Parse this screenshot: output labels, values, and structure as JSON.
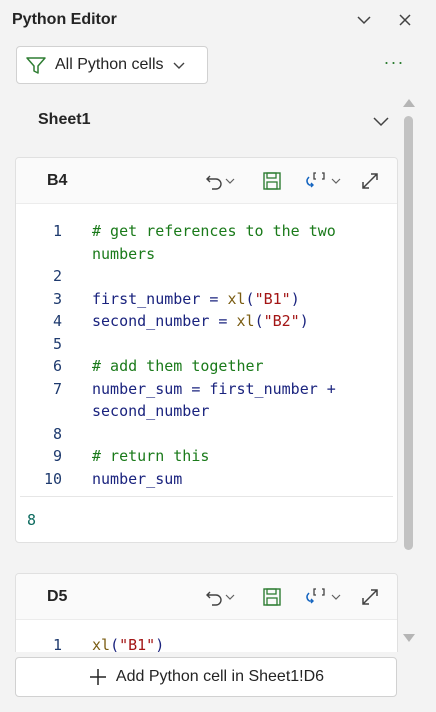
{
  "panel": {
    "title": "Python Editor"
  },
  "filter": {
    "label": "All Python cells"
  },
  "more_label": "···",
  "sheet": {
    "name": "Sheet1"
  },
  "cells": [
    {
      "ref": "B4",
      "lines": [
        {
          "num": "1",
          "parts": [
            {
              "t": "# get references to the two",
              "c": "cm"
            }
          ]
        },
        {
          "num": "",
          "parts": [
            {
              "t": "numbers",
              "c": "cm"
            }
          ]
        },
        {
          "num": "2",
          "parts": []
        },
        {
          "num": "3",
          "parts": [
            {
              "t": "first_number = ",
              "c": ""
            },
            {
              "t": "xl",
              "c": "fn"
            },
            {
              "t": "(",
              "c": ""
            },
            {
              "t": "\"B1\"",
              "c": "st"
            },
            {
              "t": ")",
              "c": ""
            }
          ]
        },
        {
          "num": "4",
          "parts": [
            {
              "t": "second_number = ",
              "c": ""
            },
            {
              "t": "xl",
              "c": "fn"
            },
            {
              "t": "(",
              "c": ""
            },
            {
              "t": "\"B2\"",
              "c": "st"
            },
            {
              "t": ")",
              "c": ""
            }
          ]
        },
        {
          "num": "5",
          "parts": []
        },
        {
          "num": "6",
          "parts": [
            {
              "t": "# add them together",
              "c": "cm"
            }
          ]
        },
        {
          "num": "7",
          "parts": [
            {
              "t": "number_sum = first_number +",
              "c": ""
            }
          ]
        },
        {
          "num": "",
          "parts": [
            {
              "t": "second_number",
              "c": ""
            }
          ]
        },
        {
          "num": "8",
          "parts": []
        },
        {
          "num": "9",
          "parts": [
            {
              "t": "# return this",
              "c": "cm"
            }
          ]
        },
        {
          "num": "10",
          "parts": [
            {
              "t": "number_sum",
              "c": ""
            }
          ]
        }
      ],
      "result": "8"
    },
    {
      "ref": "D5",
      "lines": [
        {
          "num": "1",
          "parts": [
            {
              "t": "xl",
              "c": "fn"
            },
            {
              "t": "(",
              "c": ""
            },
            {
              "t": "\"B1\"",
              "c": "st"
            },
            {
              "t": ")",
              "c": ""
            }
          ]
        }
      ]
    }
  ],
  "add_button": {
    "label": "Add Python cell in Sheet1!D6"
  }
}
